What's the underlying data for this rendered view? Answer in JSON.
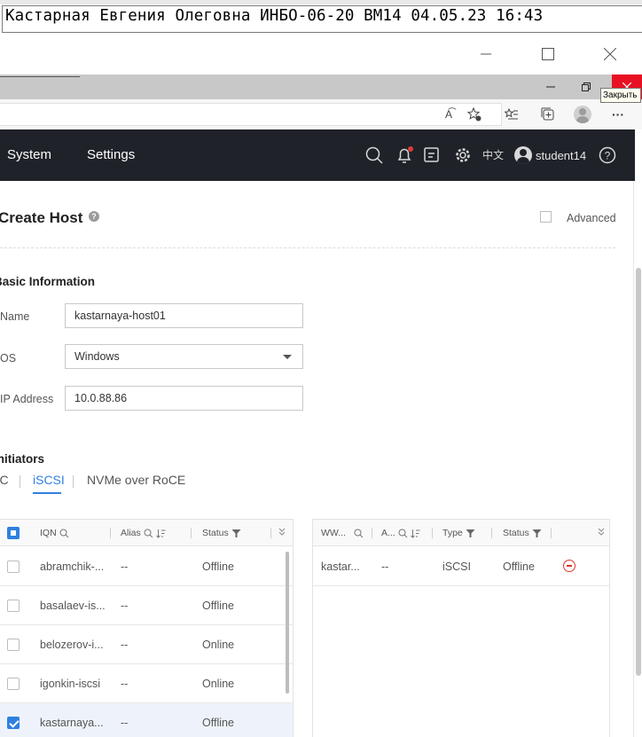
{
  "top_line": {
    "text": "Кастарная Евгения Олеговна ИНБО-06-20 ВМ14 04.05.23 16:43"
  },
  "tooltip": {
    "text": "Закрыть"
  },
  "address_bar": {
    "read_aloud": "A͡",
    "more": "···"
  },
  "nav": {
    "items": [
      "System",
      "Settings"
    ],
    "lang": "中文",
    "user": "student14"
  },
  "page": {
    "title": "Create Host",
    "advanced_label": "Advanced"
  },
  "basic_info": {
    "title": "Basic Information",
    "name_label": "Name",
    "name_value": "kastarnaya-host01",
    "os_label": "OS",
    "os_value": "Windows",
    "ip_label": "IP Address",
    "ip_value": "10.0.88.86"
  },
  "initiators": {
    "title": "Initiators",
    "tabs": [
      "FC",
      "iSCSI",
      "NVMe over RoCE"
    ],
    "active_tab": "iSCSI"
  },
  "left_table": {
    "columns": [
      "IQN",
      "Alias",
      "Status"
    ],
    "rows": [
      {
        "iqn": "abramchik-...",
        "alias": "--",
        "status": "Offline",
        "checked": false
      },
      {
        "iqn": "basalaev-is...",
        "alias": "--",
        "status": "Offline",
        "checked": false
      },
      {
        "iqn": "belozerov-i...",
        "alias": "--",
        "status": "Online",
        "checked": false
      },
      {
        "iqn": "igonkin-iscsi",
        "alias": "--",
        "status": "Online",
        "checked": false
      },
      {
        "iqn": "kastarnaya...",
        "alias": "--",
        "status": "Offline",
        "checked": true
      }
    ]
  },
  "right_table": {
    "columns": [
      "WW...",
      "A...",
      "Type",
      "Status"
    ],
    "rows": [
      {
        "ww": "kastar...",
        "alias": "--",
        "type": "iSCSI",
        "status": "Offline"
      }
    ]
  },
  "colors": {
    "accent": "#2f80e0",
    "nav_bg": "#1f2229",
    "danger": "#e0342f",
    "close_red": "#e81123"
  }
}
